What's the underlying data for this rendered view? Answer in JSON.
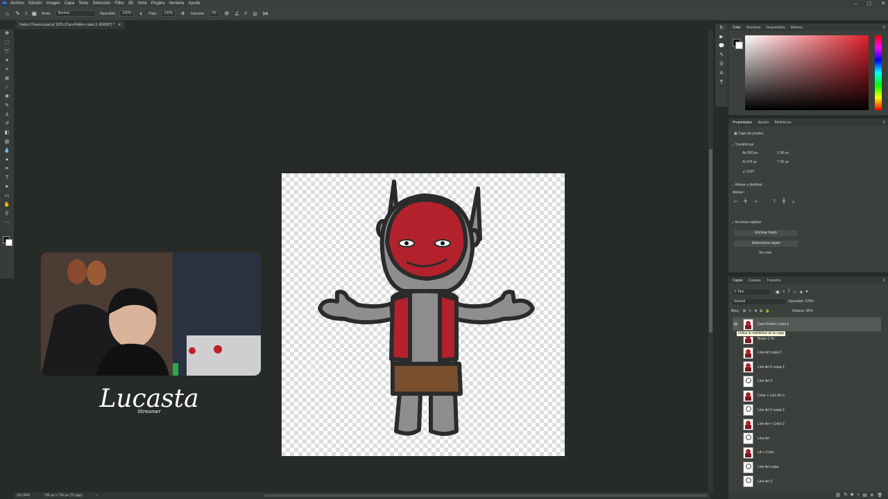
{
  "menu": {
    "items": [
      "Archivo",
      "Edición",
      "Imagen",
      "Capa",
      "Texto",
      "Selección",
      "Filtro",
      "3D",
      "Vista",
      "Plugins",
      "Ventana",
      "Ayuda"
    ]
  },
  "options": {
    "mode_label": "Modo:",
    "mode_value": "Normal",
    "opacity_label": "Opacidad:",
    "opacity_value": "100%",
    "flow_label": "Flujo:",
    "flow_value": "100%",
    "smooth_label": "Suavizar:",
    "smooth_value": "0%",
    "angle_value": "0°",
    "brush_size": "3"
  },
  "document": {
    "tab_title": "Dedos Chuecos.psd al 111% (Cara Roblox copia 2, RGB/8*) *"
  },
  "status": {
    "zoom": "110,94%",
    "size": "736 px x 736 px (72 ppp)"
  },
  "color_panel": {
    "tabs": [
      "Color",
      "Muestras",
      "Degradados",
      "Motivos"
    ],
    "fg": "#111111",
    "bg": "#ffffff",
    "hue": "#e0202c"
  },
  "properties": {
    "tabs": [
      "Propiedades",
      "Ajustes",
      "Bibliotecas"
    ],
    "layer_type": "Capa de píxeles",
    "transform_title": "Transformar",
    "w_label": "An",
    "w_value": "560 px",
    "h_label": "Al",
    "h_value": "678 px",
    "x_label": "X",
    "x_value": "90 px",
    "y_label": "Y",
    "y_value": "26 px",
    "angle_value": "0,00°",
    "align_title": "Alinear y distribuir",
    "align_sub": "Alinear:",
    "quick_title": "Acciones rápidas",
    "btn_remove_bg": "Eliminar fondo",
    "btn_select_subject": "Seleccionar sujeto",
    "see_more": "Ver más"
  },
  "layers": {
    "tabs": [
      "Capas",
      "Canales",
      "Trazados"
    ],
    "kind": "Tipo",
    "blend": "Normal",
    "opacity_label": "Opacidad:",
    "opacity_value": "100%",
    "lock_label": "Bloq.:",
    "fill_label": "Relleno:",
    "fill_value": "95%",
    "tooltip": "Indica la visibilidad de la capa",
    "rows": [
      {
        "name": "Cara Roblox copia 2",
        "thumb": "red",
        "selected": true,
        "visible": true
      },
      {
        "name": "Brazo 1 Yo",
        "thumb": "red",
        "selected": false,
        "visible": true
      },
      {
        "name": "Line Art copia 2",
        "thumb": "red",
        "selected": false,
        "visible": true
      },
      {
        "name": "Line Art 2 copia 2",
        "thumb": "red",
        "selected": false,
        "visible": true
      },
      {
        "name": "Line Art 3",
        "thumb": "line",
        "selected": false,
        "visible": true
      },
      {
        "name": "Color + Line Art 3",
        "thumb": "red",
        "selected": false,
        "visible": true
      },
      {
        "name": "Line Art 2 copia 2",
        "thumb": "line",
        "selected": false,
        "visible": true
      },
      {
        "name": "Line Art + Color 2",
        "thumb": "red",
        "selected": false,
        "visible": true
      },
      {
        "name": "Line Art",
        "thumb": "line",
        "selected": false,
        "visible": true
      },
      {
        "name": "LA + Color",
        "thumb": "red",
        "selected": false,
        "visible": true
      },
      {
        "name": "Line Art copia",
        "thumb": "line",
        "selected": false,
        "visible": true
      },
      {
        "name": "Line Art 2",
        "thumb": "line",
        "selected": false,
        "visible": true
      }
    ]
  },
  "overlay": {
    "logo_text": "Lucasta",
    "logo_sub": "Streamer"
  }
}
